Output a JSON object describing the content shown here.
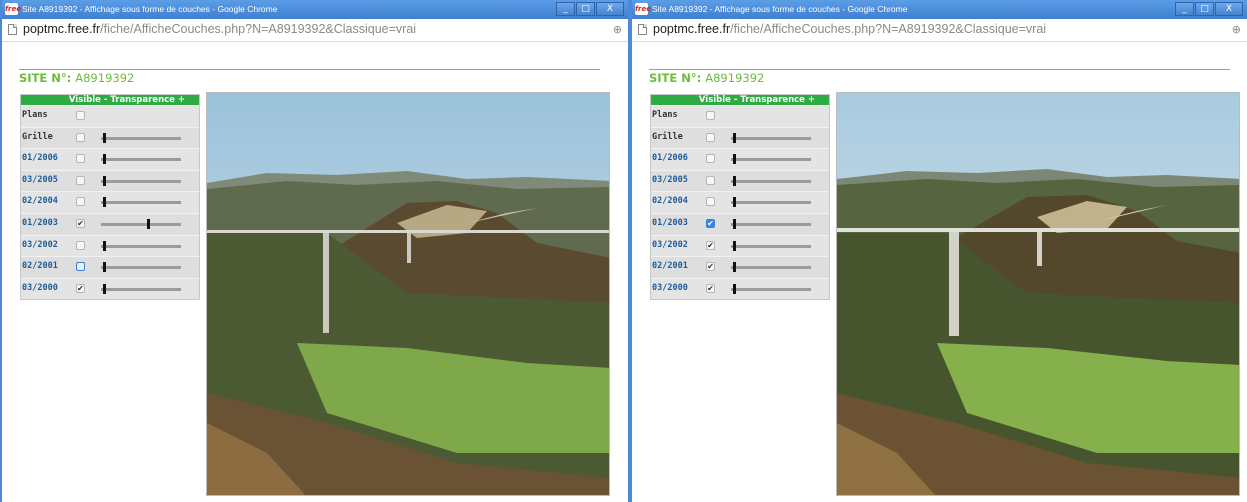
{
  "windows": [
    {
      "title": "Site A8919392 - Affichage sous forme de couches - Google Chrome",
      "app_icon_text": "free",
      "controls": [
        "_",
        "□",
        "X"
      ],
      "url_host": "poptmc.free.fr",
      "url_path": "/fiche/AfficheCouches.php?N=A8919392&Classique=vrai",
      "site_label": "SITE N°: ",
      "site_value": "A8919392",
      "header": "Visible - Transparence +",
      "layers": [
        {
          "name": "Plans",
          "checked": false,
          "slider": null
        },
        {
          "name": "Grille",
          "checked": false,
          "slider": 0.02
        },
        {
          "name": "01/2006",
          "checked": false,
          "slider": 0.02
        },
        {
          "name": "03/2005",
          "checked": false,
          "slider": 0.02
        },
        {
          "name": "02/2004",
          "checked": false,
          "slider": 0.02
        },
        {
          "name": "01/2003",
          "checked": true,
          "slider": 0.6
        },
        {
          "name": "03/2002",
          "checked": false,
          "slider": 0.02
        },
        {
          "name": "02/2001",
          "checked": false,
          "slider": 0.02,
          "focus": true
        },
        {
          "name": "03/2000",
          "checked": true,
          "slider": 0.02
        }
      ],
      "photo_tint": "#9bc2dc"
    },
    {
      "title": "Site A8919392 - Affichage sous forme de couches - Google Chrome",
      "app_icon_text": "free",
      "controls": [
        "_",
        "□",
        "X"
      ],
      "url_host": "poptmc.free.fr",
      "url_path": "/fiche/AfficheCouches.php?N=A8919392&Classique=vrai",
      "site_label": "SITE N°: ",
      "site_value": "A8919392",
      "header": "Visible - Transparence +",
      "layers": [
        {
          "name": "Plans",
          "checked": false,
          "slider": null
        },
        {
          "name": "Grille",
          "checked": false,
          "slider": 0.02
        },
        {
          "name": "01/2006",
          "checked": false,
          "slider": 0.02
        },
        {
          "name": "03/2005",
          "checked": false,
          "slider": 0.02
        },
        {
          "name": "02/2004",
          "checked": false,
          "slider": 0.02
        },
        {
          "name": "01/2003",
          "checked": true,
          "slider": 0.02,
          "focus": true
        },
        {
          "name": "03/2002",
          "checked": true,
          "slider": 0.02
        },
        {
          "name": "02/2001",
          "checked": true,
          "slider": 0.02
        },
        {
          "name": "03/2000",
          "checked": true,
          "slider": 0.02
        }
      ],
      "photo_tint": "#a9cbe0"
    }
  ],
  "icons": {
    "page": "page-icon",
    "zoom": "zoom-icon",
    "window_icon": "free-logo-icon"
  }
}
